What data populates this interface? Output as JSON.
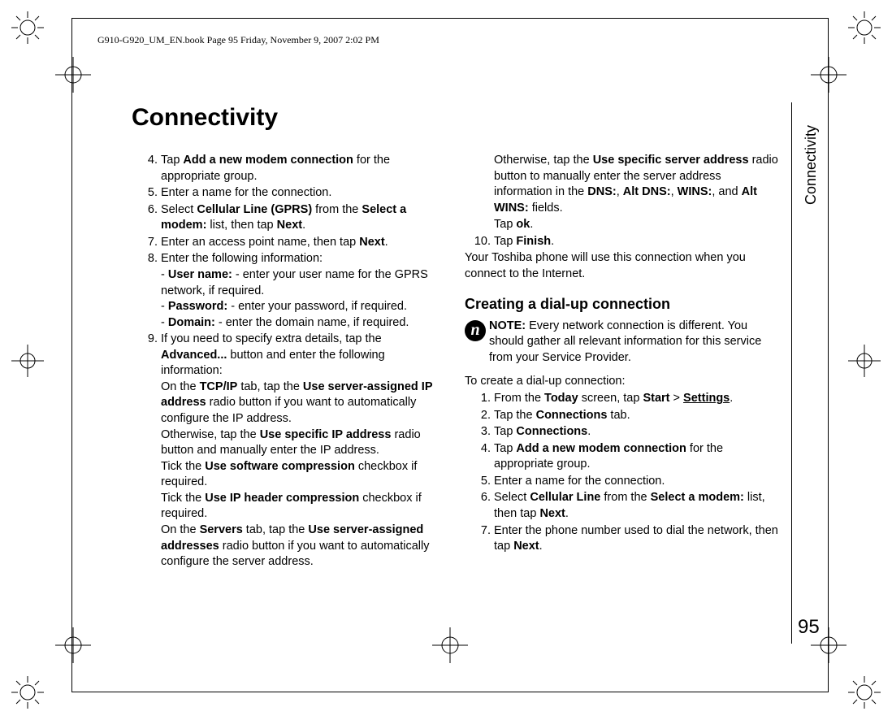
{
  "header": "G910-G920_UM_EN.book  Page 95  Friday, November 9, 2007  2:02 PM",
  "title": "Connectivity",
  "side_label": "Connectivity",
  "page_number": "95",
  "note_icon_glyph": "n",
  "col1": {
    "i4_n": "4.",
    "i4_a": "Tap ",
    "i4_b": "Add a new modem connection",
    "i4_c": " for the appropriate group.",
    "i5_n": "5.",
    "i5_t": "Enter a name for the connection.",
    "i6_n": "6.",
    "i6_a": "Select ",
    "i6_b": "Cellular Line (GPRS)",
    "i6_c": " from the ",
    "i6_d": "Select a modem:",
    "i6_e": " list, then tap ",
    "i6_f": "Next",
    "i6_g": ".",
    "i7_n": "7.",
    "i7_a": "Enter an access point name, then tap ",
    "i7_b": "Next",
    "i7_c": ".",
    "i8_n": "8.",
    "i8_t": "Enter the following information:",
    "i8u_a": "- ",
    "i8u_b": "User name:",
    "i8u_c": " - enter your user name for the GPRS network, if required.",
    "i8p_a": "- ",
    "i8p_b": "Password:",
    "i8p_c": " - enter your password, if required.",
    "i8d_a": "- ",
    "i8d_b": "Domain:",
    "i8d_c": " - enter the domain name, if required.",
    "i9_n": "9.",
    "i9_a": "If you need to specify extra details, tap the ",
    "i9_b": "Advanced...",
    "i9_c": " button and enter the following information:",
    "i9t_a": "On the ",
    "i9t_b": "TCP/IP",
    "i9t_c": " tab, tap the ",
    "i9t_d": "Use server-assigned IP address",
    "i9t_e": " radio button if you want to automatically configure the IP address.",
    "i9o_a": "Otherwise, tap the ",
    "i9o_b": "Use specific IP address",
    "i9o_c": " radio button and manually enter the IP address.",
    "i9s_a": "Tick the ",
    "i9s_b": "Use software compression",
    "i9s_c": " checkbox if required.",
    "i9h_a": "Tick the ",
    "i9h_b": "Use IP header compression",
    "i9h_c": " checkbox if required.",
    "i9v_a": "On the ",
    "i9v_b": "Servers",
    "i9v_c": " tab, tap the ",
    "i9v_d": "Use server-assigned addresses",
    "i9v_e": " radio button if you want to automatically configure the server address."
  },
  "col2": {
    "top_a": "Otherwise, tap the ",
    "top_b": "Use specific server address",
    "top_c": " radio button to manually enter the server address information in the ",
    "top_d": "DNS:",
    "top_e": ", ",
    "top_f": "Alt DNS:",
    "top_g": ", ",
    "top_h": "WINS:",
    "top_i": ", and ",
    "top_j": "Alt WINS:",
    "top_k": " fields.",
    "tapok_a": "Tap ",
    "tapok_b": "ok",
    "tapok_c": ".",
    "i10_n": "10.",
    "i10_a": "Tap ",
    "i10_b": "Finish",
    "i10_c": ".",
    "outro": "Your Toshiba phone will use this connection when you connect to the Internet.",
    "heading": "Creating a dial-up connection",
    "note_a": "NOTE:",
    "note_b": " Every network connection is different. You should gather all relevant information for this service from your Service Provider.",
    "lead": "To create a dial-up connection:",
    "d1_n": "1.",
    "d1_a": "From the ",
    "d1_b": "Today",
    "d1_c": " screen, tap ",
    "d1_d": "Start",
    "d1_e": " > ",
    "d1_f": "Settings",
    "d1_g": ".",
    "d2_n": "2.",
    "d2_a": "Tap the ",
    "d2_b": "Connections",
    "d2_c": " tab.",
    "d3_n": "3.",
    "d3_a": "Tap ",
    "d3_b": "Connections",
    "d3_c": ".",
    "d4_n": "4.",
    "d4_a": "Tap ",
    "d4_b": "Add a new modem connection",
    "d4_c": " for the appropriate group.",
    "d5_n": "5.",
    "d5_t": "Enter a name for the connection.",
    "d6_n": "6.",
    "d6_a": "Select ",
    "d6_b": "Cellular Line",
    "d6_c": " from the ",
    "d6_d": "Select a modem:",
    "d6_e": " list, then tap ",
    "d6_f": "Next",
    "d6_g": ".",
    "d7_n": "7.",
    "d7_a": "Enter the phone number used to dial the network, then tap ",
    "d7_b": "Next",
    "d7_c": "."
  }
}
